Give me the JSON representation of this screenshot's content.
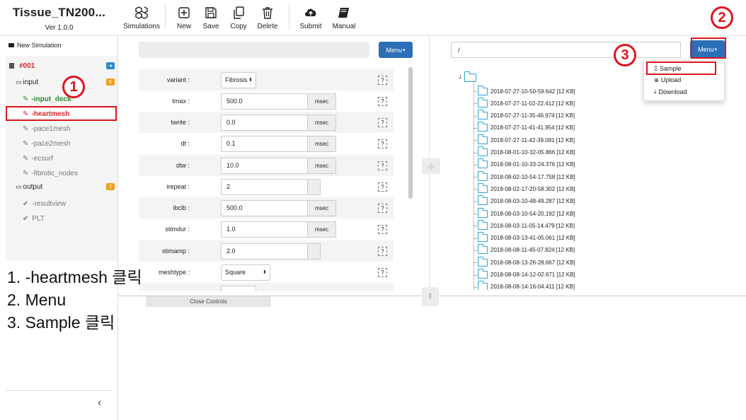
{
  "app": {
    "title": "Tissue_TN200...",
    "version": "Ver 1.0.0"
  },
  "toolbar": {
    "simulations": "Simulations",
    "new": "New",
    "save": "Save",
    "copy": "Copy",
    "delete": "Delete",
    "submit": "Submit",
    "manual": "Manual"
  },
  "sidebar": {
    "new_simulation": "New Simulation",
    "sim_id": "#001",
    "input_label": "input",
    "input_badge": "6",
    "output_label": "output",
    "output_badge": "2",
    "input_items": [
      "-input_deck",
      "-heartmesh",
      "-pace1mesh",
      "-pace2mesh",
      "-ecsurf",
      "-fibrotic_nodes"
    ],
    "output_items": [
      "-resultview",
      "PLT"
    ],
    "collapse": "‹"
  },
  "middle": {
    "menu_label": "Menu",
    "close_controls": "Close Controls",
    "params": [
      {
        "label": "variant :",
        "value": "Fibrosis",
        "unit": "",
        "kind": "select"
      },
      {
        "label": "tmax :",
        "value": "500.0",
        "unit": "msec",
        "kind": "input"
      },
      {
        "label": "twrite :",
        "value": "0.0",
        "unit": "msec",
        "kind": "input"
      },
      {
        "label": "dt :",
        "value": "0.1",
        "unit": "msec",
        "kind": "input"
      },
      {
        "label": "dtw :",
        "value": "10.0",
        "unit": "msec",
        "kind": "input"
      },
      {
        "label": "irepeat :",
        "value": "2",
        "unit": "",
        "kind": "input"
      },
      {
        "label": "ibclb :",
        "value": "500.0",
        "unit": "msec",
        "kind": "input"
      },
      {
        "label": "stimdur :",
        "value": "1.0",
        "unit": "msec",
        "kind": "input"
      },
      {
        "label": "stimamp :",
        "value": "2.0",
        "unit": "",
        "kind": "input"
      },
      {
        "label": "meshtype :",
        "value": "Square",
        "unit": "",
        "kind": "select2"
      }
    ],
    "help": "?"
  },
  "right": {
    "path": "/",
    "menu_label": "Menu",
    "files": [
      "2018-07-27-10-50-59.642 [12 KB]",
      "2018-07-27-11-02-22.412 [12 KB]",
      "2018-07-27-11-35-46.974 [12 KB]",
      "2018-07-27-11-41-41.954 [12 KB]",
      "2018-07-27-11-42-39.081 [12 KB]",
      "2018-08-01-10-32-05.866 [12 KB]",
      "2018-08-01-10-33-24.376 [12 KB]",
      "2018-08-02-10-54-17.758 [12 KB]",
      "2018-08-02-17-20-58.302 [12 KB]",
      "2018-08-03-10-48-49.287 [12 KB]",
      "2018-08-03-10-54-20.192 [12 KB]",
      "2018-08-03-11-05-14.479 [12 KB]",
      "2018-08-03-13-41-05.061 [12 KB]",
      "2018-08-08-11-45-07.824 [12 KB]",
      "2018-08-08-13-26-28.667 [12 KB]",
      "2018-08-08-14-12-02.671 [12 KB]",
      "2018-08-08-14-16-04.411 [12 KB]"
    ],
    "dropdown": {
      "sample": "Sample",
      "upload": "Upload",
      "download": "Download"
    }
  },
  "annotations": {
    "c1": "1",
    "c2": "2",
    "c3": "3",
    "step1": "1. -heartmesh 클릭",
    "step2": "2. Menu",
    "step3": "3. Sample 클릭"
  },
  "colors": {
    "accent": "#2d6fb7",
    "annotation": "#e0141c",
    "active_red": "#d9262e",
    "green": "#2e8b2e",
    "badge_blue": "#2d8ac9",
    "badge_orange": "#f0a020"
  }
}
